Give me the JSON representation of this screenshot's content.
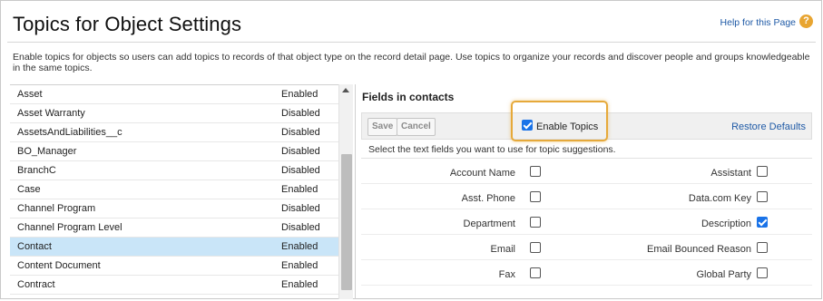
{
  "header": {
    "title": "Topics for Object Settings",
    "help_label": "Help for this Page",
    "help_icon": "help-icon",
    "help_color": "#e8a531"
  },
  "description": "Enable topics for objects so users can add topics to records of that object type on the record detail page. Use topics to organize your records and discover people and groups knowledgeable in the same topics.",
  "objects": [
    {
      "name": "Asset",
      "status": "Enabled"
    },
    {
      "name": "Asset Warranty",
      "status": "Disabled"
    },
    {
      "name": "AssetsAndLiabilities__c",
      "status": "Disabled"
    },
    {
      "name": "BO_Manager",
      "status": "Disabled"
    },
    {
      "name": "BranchC",
      "status": "Disabled"
    },
    {
      "name": "Case",
      "status": "Enabled"
    },
    {
      "name": "Channel Program",
      "status": "Disabled"
    },
    {
      "name": "Channel Program Level",
      "status": "Disabled"
    },
    {
      "name": "Contact",
      "status": "Enabled",
      "selected": true
    },
    {
      "name": "Content Document",
      "status": "Enabled"
    },
    {
      "name": "Contract",
      "status": "Enabled"
    }
  ],
  "fields_panel": {
    "title": "Fields in contacts",
    "save_label": "Save",
    "cancel_label": "Cancel",
    "enable_topics_label": "Enable Topics",
    "enable_topics_checked": true,
    "restore_label": "Restore Defaults",
    "instruction": "Select the text fields you want to use for topic suggestions.",
    "highlight_color": "#e6a93a",
    "check_color": "#1a73e8",
    "rows": [
      {
        "left": {
          "label": "Account Name",
          "checked": false
        },
        "right": {
          "label": "Assistant",
          "checked": false
        }
      },
      {
        "left": {
          "label": "Asst. Phone",
          "checked": false
        },
        "right": {
          "label": "Data.com Key",
          "checked": false
        }
      },
      {
        "left": {
          "label": "Department",
          "checked": false
        },
        "right": {
          "label": "Description",
          "checked": true
        }
      },
      {
        "left": {
          "label": "Email",
          "checked": false
        },
        "right": {
          "label": "Email Bounced Reason",
          "checked": false
        }
      },
      {
        "left": {
          "label": "Fax",
          "checked": false
        },
        "right": {
          "label": "Global Party",
          "checked": false
        }
      }
    ]
  }
}
